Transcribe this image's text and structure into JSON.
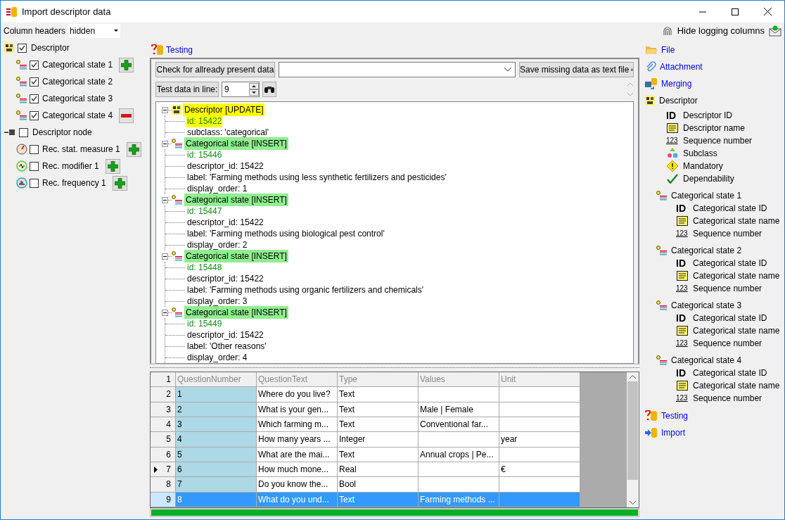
{
  "window": {
    "title": "Import descriptor data"
  },
  "column_headers": {
    "label": "Column headers",
    "value": "hidden"
  },
  "hide_logging": {
    "label": "Hide logging columns"
  },
  "left_tree": [
    {
      "label": "Descriptor",
      "checked": true,
      "kind": "descriptor",
      "children": [
        {
          "label": "Categorical state 1",
          "checked": true,
          "kind": "categorical",
          "add": true,
          "remove": false
        },
        {
          "label": "Categorical state 2",
          "checked": true,
          "kind": "categorical",
          "add": false,
          "remove": false
        },
        {
          "label": "Categorical state 3",
          "checked": true,
          "kind": "categorical",
          "add": false,
          "remove": false
        },
        {
          "label": "Categorical state 4",
          "checked": true,
          "kind": "categorical",
          "add": false,
          "remove": true
        }
      ]
    },
    {
      "label": "Descriptor node",
      "checked": false,
      "kind": "node",
      "children": [
        {
          "label": "Rec. stat. measure 1",
          "checked": false,
          "kind": "measure",
          "add": true,
          "remove": false
        },
        {
          "label": "Rec. modifier 1",
          "checked": false,
          "kind": "modifier",
          "add": true,
          "remove": false
        },
        {
          "label": "Rec. frequency 1",
          "checked": false,
          "kind": "frequency",
          "add": true,
          "remove": false
        }
      ]
    }
  ],
  "testing": {
    "title": "Testing",
    "check_button": "Check for allready present data",
    "save_button": "Save missing data as text file",
    "test_line_label": "Test data in line:",
    "test_line_value": "9",
    "result_tree": [
      {
        "label": "Descriptor [UPDATE]",
        "kind": "update",
        "expanded": true,
        "children": [
          {
            "label": "id: 15422",
            "kind": "key"
          },
          {
            "label": "subclass: 'categorical'",
            "kind": "plain"
          }
        ]
      },
      {
        "label": "Categorical state [INSERT]",
        "kind": "insert",
        "expanded": true,
        "children": [
          {
            "label": "id: 15446",
            "kind": "key"
          },
          {
            "label": "descriptor_id: 15422",
            "kind": "plain"
          },
          {
            "label": "label: 'Farming methods using less synthetic fertilizers and pesticides'",
            "kind": "plain"
          },
          {
            "label": "display_order: 1",
            "kind": "plain"
          }
        ]
      },
      {
        "label": "Categorical state [INSERT]",
        "kind": "insert",
        "expanded": true,
        "children": [
          {
            "label": "id: 15447",
            "kind": "key"
          },
          {
            "label": "descriptor_id: 15422",
            "kind": "plain"
          },
          {
            "label": "label: 'Farming methods using biological pest control'",
            "kind": "plain"
          },
          {
            "label": "display_order: 2",
            "kind": "plain"
          }
        ]
      },
      {
        "label": "Categorical state [INSERT]",
        "kind": "insert",
        "expanded": true,
        "children": [
          {
            "label": "id: 15448",
            "kind": "key"
          },
          {
            "label": "descriptor_id: 15422",
            "kind": "plain"
          },
          {
            "label": "label: 'Farming methods using organic fertilizers and chemicals'",
            "kind": "plain"
          },
          {
            "label": "display_order: 3",
            "kind": "plain"
          }
        ]
      },
      {
        "label": "Categorical state [INSERT]",
        "kind": "insert",
        "expanded": true,
        "children": [
          {
            "label": "id: 15449",
            "kind": "key"
          },
          {
            "label": "descriptor_id: 15422",
            "kind": "plain"
          },
          {
            "label": "label: 'Other reasons'",
            "kind": "plain"
          },
          {
            "label": "display_order: 4",
            "kind": "plain"
          }
        ]
      }
    ]
  },
  "grid": {
    "header_row": {
      "number": "1",
      "cells": [
        "QuestionNumber",
        "QuestionText",
        "Type",
        "Values",
        "Unit"
      ]
    },
    "rows": [
      {
        "number": "2",
        "question_number": "1",
        "question_text": "Where do you live?",
        "type": "Text",
        "current": false,
        "selected": false
      },
      {
        "number": "3",
        "question_number": "2",
        "question_text": "What is your gen...",
        "type": "Text",
        "values": "Male | Female",
        "current": false,
        "selected": false
      },
      {
        "number": "4",
        "question_number": "3",
        "question_text": "Which farming m...",
        "type": "Text",
        "values": "Conventional far...",
        "current": false,
        "selected": false
      },
      {
        "number": "5",
        "question_number": "4",
        "question_text": "How many years ...",
        "type": "Integer",
        "unit": "year",
        "current": false,
        "selected": false
      },
      {
        "number": "6",
        "question_number": "5",
        "question_text": "What are the mai...",
        "type": "Text",
        "values": "Annual crops | Pe...",
        "current": false,
        "selected": false
      },
      {
        "number": "7",
        "question_number": "6",
        "question_text": "How much mone...",
        "type": "Real",
        "unit": "€",
        "current": true,
        "selected": false
      },
      {
        "number": "8",
        "question_number": "7",
        "question_text": "Do you know the...",
        "type": "Bool",
        "current": false,
        "selected": false
      },
      {
        "number": "9",
        "question_number": "8",
        "question_text": "What do you und...",
        "type": "Text",
        "values": "Farming methods ...",
        "current": false,
        "selected": true
      }
    ]
  },
  "progress": {
    "level": 1
  },
  "right_nav": [
    {
      "kind": "file",
      "label": "File"
    },
    {
      "kind": "attachment",
      "label": "Attachment"
    },
    {
      "kind": "merging",
      "label": "Merging"
    },
    {
      "kind": "group",
      "label": "Descriptor",
      "fields": [
        {
          "kind": "id",
          "glyph": "ID",
          "label": "Descriptor ID"
        },
        {
          "kind": "name",
          "label": "Descriptor name"
        },
        {
          "kind": "sequence",
          "glyph": "123",
          "label": "Sequence number"
        },
        {
          "kind": "subclass",
          "label": "Subclass"
        },
        {
          "kind": "mandatory",
          "label": "Mandatory"
        },
        {
          "kind": "dependability",
          "label": "Dependability"
        }
      ],
      "children": [
        {
          "label": "Categorical state 1",
          "fields": [
            {
              "kind": "id",
              "glyph": "ID",
              "label": "Categorical state ID"
            },
            {
              "kind": "name",
              "label": "Categorical state name"
            },
            {
              "kind": "sequence",
              "glyph": "123",
              "label": "Sequence number"
            }
          ]
        },
        {
          "label": "Categorical state 2",
          "fields": [
            {
              "kind": "id",
              "glyph": "ID",
              "label": "Categorical state ID"
            },
            {
              "kind": "name",
              "label": "Categorical state name"
            },
            {
              "kind": "sequence",
              "glyph": "123",
              "label": "Sequence number"
            }
          ]
        },
        {
          "label": "Categorical state 3",
          "fields": [
            {
              "kind": "id",
              "glyph": "ID",
              "label": "Categorical state ID"
            },
            {
              "kind": "name",
              "label": "Categorical state name"
            },
            {
              "kind": "sequence",
              "glyph": "123",
              "label": "Sequence number"
            }
          ]
        },
        {
          "label": "Categorical state 4",
          "fields": [
            {
              "kind": "id",
              "glyph": "ID",
              "label": "Categorical state ID"
            },
            {
              "kind": "name",
              "label": "Categorical state name"
            },
            {
              "kind": "sequence",
              "glyph": "123",
              "label": "Sequence number"
            }
          ]
        }
      ]
    },
    {
      "kind": "testing",
      "label": "Testing"
    },
    {
      "kind": "import",
      "label": "Import"
    }
  ]
}
